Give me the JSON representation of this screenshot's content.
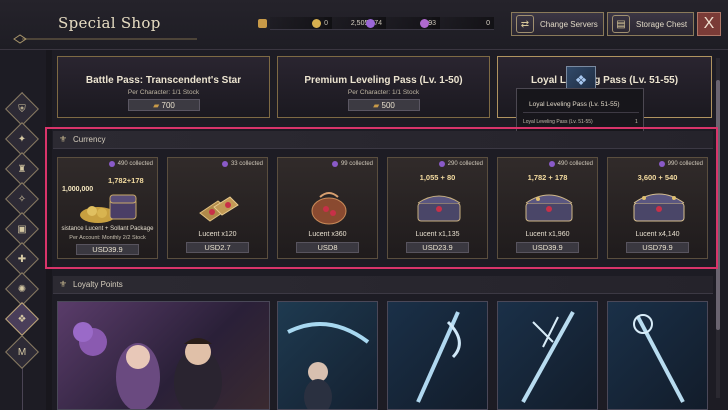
{
  "header": {
    "title": "Special Shop",
    "currencies": [
      {
        "icon": "ticket-icon",
        "value": "0",
        "color": "#c89a48"
      },
      {
        "icon": "gold-coin-icon",
        "value": "2,505,574",
        "color": "#d8b050"
      },
      {
        "icon": "lucent-icon",
        "value": "93",
        "color": "#9a66d8"
      },
      {
        "icon": "sollant-icon",
        "value": "0",
        "color": "#b06ad0"
      }
    ],
    "change_servers_label": "Change Servers",
    "storage_chest_label": "Storage Chest",
    "close_label": "X"
  },
  "sidebar": {
    "items": [
      {
        "icon": "shield-icon",
        "glyph": "⛨"
      },
      {
        "icon": "crest-icon",
        "glyph": "✦"
      },
      {
        "icon": "helmet-icon",
        "glyph": "♜"
      },
      {
        "icon": "pass-icon",
        "glyph": "✧"
      },
      {
        "icon": "chest-icon",
        "glyph": "▣"
      },
      {
        "icon": "gift-icon",
        "glyph": "✚"
      },
      {
        "icon": "special-icon",
        "glyph": "✺"
      },
      {
        "icon": "medal-icon",
        "glyph": "M"
      }
    ]
  },
  "passes": [
    {
      "name": "Battle Pass: Transcendent's Star",
      "stock": "Per Character: 1/1 Stock",
      "price": "700"
    },
    {
      "name": "Premium Leveling Pass (Lv. 1-50)",
      "stock": "Per Character: 1/1 Stock",
      "price": "500"
    },
    {
      "name": "Loyal Leveling Pass (Lv. 51-55)",
      "stock": "",
      "price": ""
    }
  ],
  "tooltip": {
    "title": "Loyal Leveling Pass (Lv. 51-55)",
    "item": "Loyal Leveling Pass (Lv. 51-55)",
    "count": "1"
  },
  "sections": {
    "currency": "Currency",
    "loyalty": "Loyalty Points"
  },
  "currency_items": [
    {
      "collected": "490 collected",
      "amount": "1,782+178",
      "amount2": "1,000,000",
      "name": "sistance Lucent + Sollant Package",
      "sub": "Per Account: Monthly 2/2 Stock",
      "price": "USD39.9"
    },
    {
      "collected": "33 collected",
      "amount": "",
      "name": "Lucent x120",
      "price": "USD2.7"
    },
    {
      "collected": "99 collected",
      "amount": "",
      "name": "Lucent x360",
      "price": "USD8"
    },
    {
      "collected": "290 collected",
      "amount": "1,055 + 80",
      "name": "Lucent x1,135",
      "price": "USD23.9"
    },
    {
      "collected": "490 collected",
      "amount": "1,782 + 178",
      "name": "Lucent x1,960",
      "price": "USD39.9"
    },
    {
      "collected": "990 collected",
      "amount": "3,600 + 540",
      "name": "Lucent x4,140",
      "price": "USD79.9"
    }
  ],
  "colors": {
    "highlight": "#d8346a",
    "gold_border": "#7e6a44",
    "lucent": "#8a5ac8"
  }
}
